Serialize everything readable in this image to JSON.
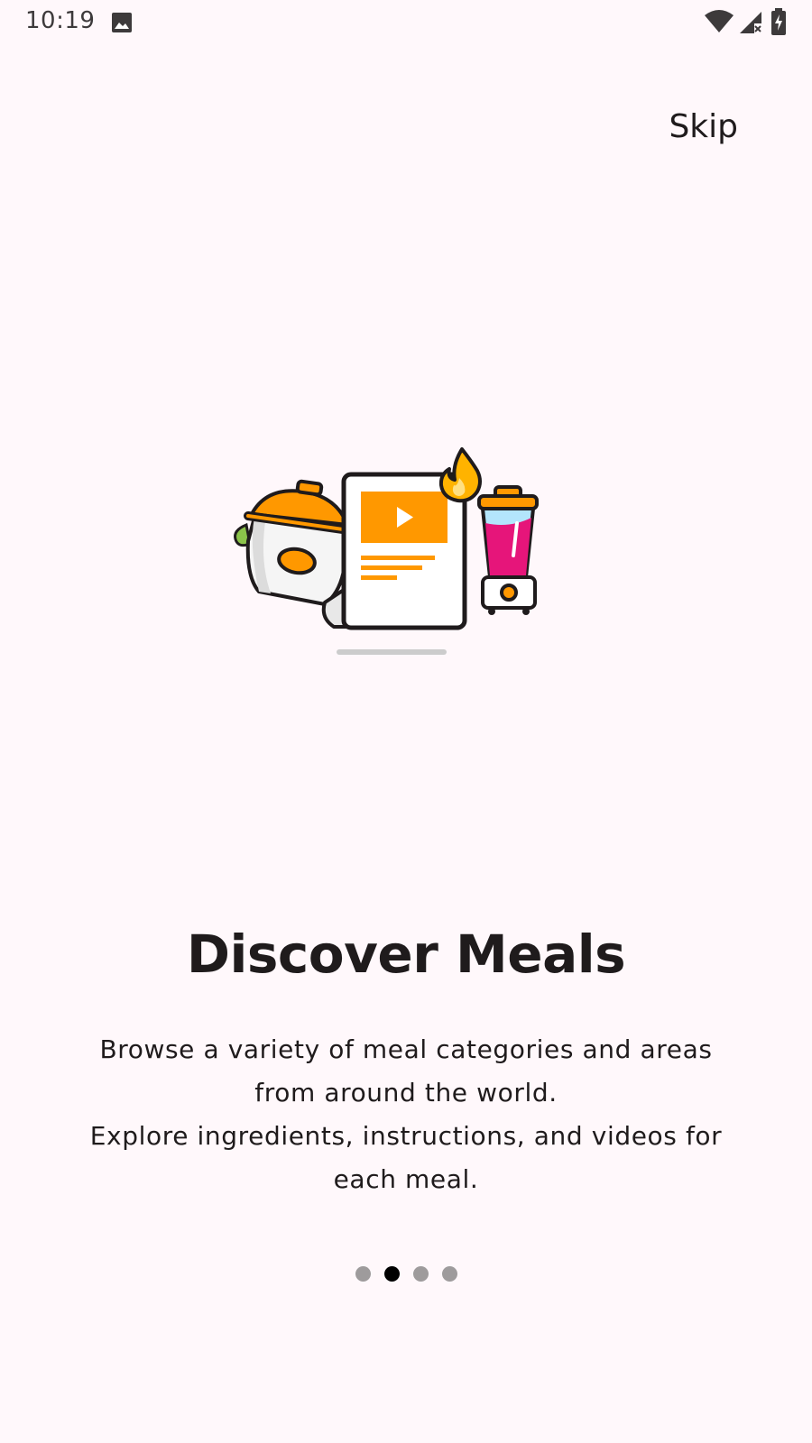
{
  "status_bar": {
    "time": "10:19",
    "icons": [
      "image-icon",
      "wifi-icon",
      "signal-icon",
      "battery-icon"
    ]
  },
  "top_bar": {
    "skip_label": "Skip"
  },
  "onboarding": {
    "illustration": "cooking-recipe-video-blender-illustration",
    "title": "Discover Meals",
    "description_lines": [
      "Browse a variety of meal categories and areas",
      "from around the world.",
      "Explore ingredients, instructions, and videos for",
      "each meal."
    ],
    "page_indicator": {
      "total_pages": 4,
      "current_page": 2
    }
  },
  "colors": {
    "background": "#FFF8FB",
    "accent_orange": "#FF9800",
    "accent_pink": "#E6157A",
    "dot_inactive": "#9E9B9C",
    "dot_active": "#000000"
  }
}
